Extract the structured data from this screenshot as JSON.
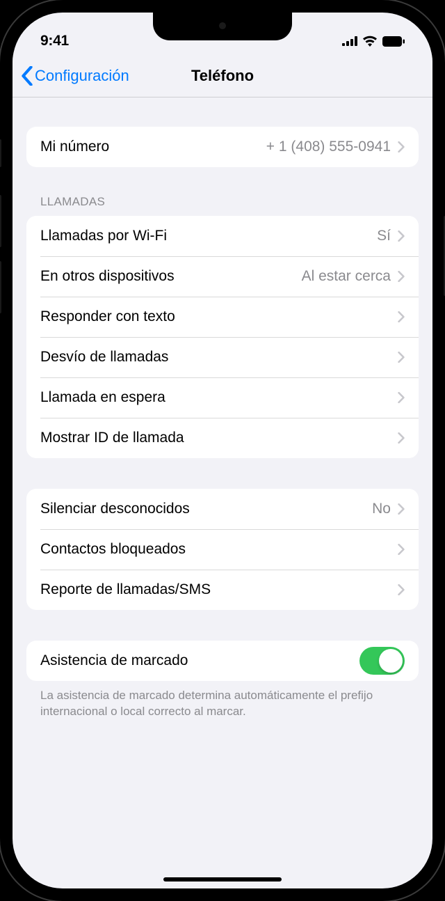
{
  "statusBar": {
    "time": "9:41"
  },
  "nav": {
    "back": "Configuración",
    "title": "Teléfono"
  },
  "sections": {
    "myNumber": {
      "label": "Mi número",
      "value": "+ 1 (408) 555-0941"
    },
    "callsHeader": "LLAMADAS",
    "calls": {
      "wifiCalling": {
        "label": "Llamadas por Wi-Fi",
        "value": "Sí"
      },
      "otherDevices": {
        "label": "En otros dispositivos",
        "value": "Al estar cerca"
      },
      "respondText": {
        "label": "Responder con texto"
      },
      "callForwarding": {
        "label": "Desvío de llamadas"
      },
      "callWaiting": {
        "label": "Llamada en espera"
      },
      "showCallerId": {
        "label": "Mostrar ID de llamada"
      }
    },
    "blocking": {
      "silenceUnknown": {
        "label": "Silenciar desconocidos",
        "value": "No"
      },
      "blockedContacts": {
        "label": "Contactos bloqueados"
      },
      "callSmsReport": {
        "label": "Reporte de llamadas/SMS"
      }
    },
    "dialAssist": {
      "label": "Asistencia de marcado",
      "enabled": true
    },
    "dialAssistFooter": "La asistencia de marcado determina automáticamente el prefijo internacional o local correcto al marcar."
  }
}
